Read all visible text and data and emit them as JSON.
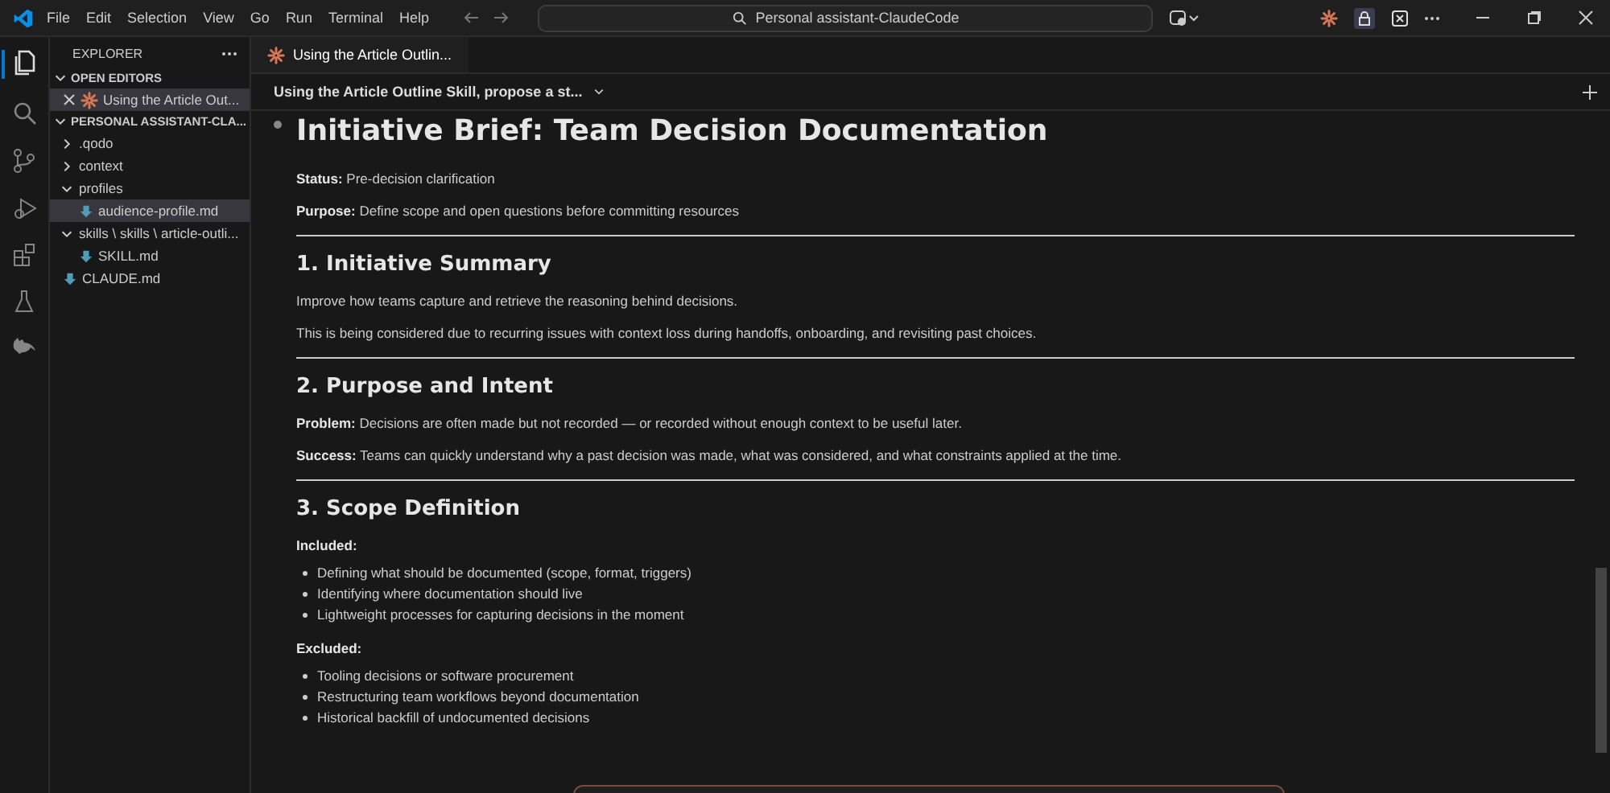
{
  "menu": [
    "File",
    "Edit",
    "Selection",
    "View",
    "Go",
    "Run",
    "Terminal",
    "Help"
  ],
  "command_center": {
    "text": "Personal assistant-ClaudeCode"
  },
  "sidebar": {
    "title": "EXPLORER",
    "open_editors": {
      "title": "OPEN EDITORS",
      "expanded": true,
      "items": [
        {
          "label": "Using the Article Out...",
          "selected": true
        }
      ]
    },
    "project": {
      "title": "PERSONAL ASSISTANT-CLA...",
      "expanded": true,
      "items": [
        {
          "kind": "folder",
          "label": ".qodo",
          "expanded": false,
          "selected": false
        },
        {
          "kind": "folder",
          "label": "context",
          "expanded": false,
          "selected": false
        },
        {
          "kind": "folder",
          "label": "profiles",
          "expanded": true,
          "selected": false,
          "children": [
            {
              "kind": "file",
              "label": "audience-profile.md",
              "selected": true
            }
          ]
        },
        {
          "kind": "folder",
          "label": "skills \\ skills \\ article-outli...",
          "expanded": true,
          "selected": false,
          "children": [
            {
              "kind": "file",
              "label": "SKILL.md",
              "selected": false
            }
          ]
        },
        {
          "kind": "file",
          "label": "CLAUDE.md",
          "selected": false
        }
      ]
    }
  },
  "editor_tab": {
    "label": "Using the Article Outlin..."
  },
  "chat_title": "Using the Article Outline Skill, propose a st...",
  "document": [
    {
      "kind": "h1",
      "text": "Initiative Brief: Team Decision Documentation"
    },
    {
      "kind": "p",
      "text": "**Status:** Pre-decision clarification"
    },
    {
      "kind": "p",
      "text": "**Purpose:** Define scope and open questions before committing resources"
    },
    {
      "kind": "rule"
    },
    {
      "kind": "h2",
      "text": "1. Initiative Summary"
    },
    {
      "kind": "p",
      "text": "Improve how teams capture and retrieve the reasoning behind decisions."
    },
    {
      "kind": "p",
      "text": "This is being considered due to recurring issues with context loss during handoffs, onboarding, and revisiting past choices."
    },
    {
      "kind": "rule"
    },
    {
      "kind": "h2",
      "text": "2. Purpose and Intent"
    },
    {
      "kind": "p",
      "text": "**Problem:** Decisions are often made but not recorded — or recorded without enough context to be useful later."
    },
    {
      "kind": "p",
      "text": "**Success:** Teams can quickly understand why a past decision was made, what was considered, and what constraints applied at the time."
    },
    {
      "kind": "rule"
    },
    {
      "kind": "h2",
      "text": "3. Scope Definition"
    },
    {
      "kind": "p",
      "text": "**Included:**"
    },
    {
      "kind": "list",
      "items": [
        "Defining what should be documented (scope, format, triggers)",
        "Identifying where documentation should live",
        "Lightweight processes for capturing decisions in the moment"
      ]
    },
    {
      "kind": "p",
      "text": "**Excluded:**"
    },
    {
      "kind": "list",
      "items": [
        "Tooling decisions or software procurement",
        "Restructuring team workflows beyond documentation",
        "Historical backfill of undocumented decisions"
      ]
    }
  ]
}
